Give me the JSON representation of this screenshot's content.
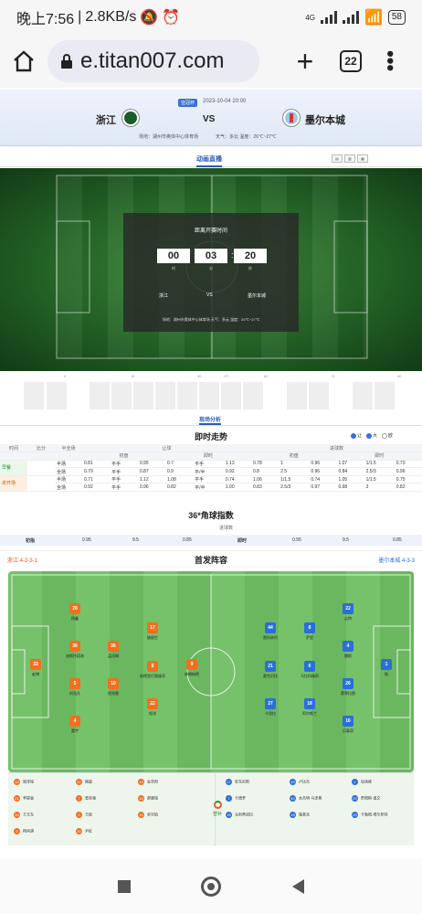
{
  "status": {
    "time": "晚上7:56",
    "speed": "2.8KB/s",
    "network": "4G",
    "battery": "58"
  },
  "browser": {
    "url": "e.titan007.com",
    "tab_count": "22"
  },
  "match": {
    "tag": "亚冠杯",
    "datetime": "2023-10-04 20:00",
    "home": "浙江",
    "vs": "VS",
    "away": "墨尔本城",
    "venue": "场地：湖州市奥体中心体育场",
    "weather": "天气：多云    温度：26℃~27℃"
  },
  "live": {
    "title": "动画直播",
    "view_buttons": [
      "▤",
      "▥",
      "▦"
    ]
  },
  "countdown": {
    "title": "距离开赛时间",
    "hours": "00",
    "minutes": "03",
    "seconds": "20",
    "h_unit": "时",
    "m_unit": "分",
    "s_unit": "秒",
    "home": "浙江",
    "vs": "VS",
    "away": "墨尔本城",
    "footer": "场地：湖州市奥体中心体育场 天气：多云 温度：26℃~27℃"
  },
  "timeline_ticks": [
    "0",
    "15",
    "30",
    "HT",
    "60",
    "75",
    "90"
  ],
  "analysis_tab": "现场分析",
  "odds": {
    "title": "即时走势",
    "legend": [
      "让",
      "大",
      "欧"
    ],
    "head1": [
      "时间",
      "比分",
      "半全场",
      "让球",
      "",
      "",
      "",
      "",
      "",
      "进球数",
      "",
      "",
      "",
      "",
      ""
    ],
    "head2": [
      "",
      "",
      "",
      "初盘",
      "",
      "",
      "即时",
      "",
      "",
      "初盘",
      "",
      "",
      "即时",
      "",
      ""
    ],
    "rows": [
      {
        "label": "早餐",
        "cells": [
          "半场",
          "0.81",
          "平手",
          "0.95",
          "0.7",
          "平手",
          "1.13",
          "0.78",
          "1",
          "0.96",
          "1.07",
          "1/1.5",
          "0.73"
        ]
      },
      {
        "label": "",
        "cells": [
          "全场",
          "0.79",
          "平手",
          "0.87",
          "0.9",
          "平/半",
          "0.92",
          "0.8",
          "2.5",
          "0.96",
          "0.84",
          "2.5/3",
          "0.96"
        ]
      },
      {
        "label": "未开场",
        "cells": [
          "半场",
          "0.71",
          "平手",
          "1.12",
          "1.08",
          "平手",
          "0.74",
          "1.06",
          "1/1.5",
          "0.74",
          "1.05",
          "1/1.5",
          "0.75"
        ]
      },
      {
        "label": "",
        "cells": [
          "全场",
          "0.92",
          "平手",
          "0.96",
          "0.82",
          "平/半",
          "1.00",
          "0.83",
          "2.5/3",
          "0.97",
          "0.98",
          "3",
          "0.82"
        ]
      }
    ]
  },
  "corner": {
    "title": "36*角球指数",
    "head": "进球数",
    "row": [
      "初指",
      "0.95",
      "9.5",
      "0.85",
      "即时",
      "0.95",
      "9.5",
      "0.85"
    ]
  },
  "lineup": {
    "home_formation": "浙江 4-2-3-1",
    "title": "首发阵容",
    "away_formation": "墨尔本城 4-3-3",
    "home_players": [
      {
        "num": "33",
        "name": "赵博"
      },
      {
        "num": "28",
        "name": "杨鑫"
      },
      {
        "num": "36",
        "name": "迪斯托塔洛"
      },
      {
        "num": "5",
        "name": "刘浩凡"
      },
      {
        "num": "4",
        "name": "董宇"
      },
      {
        "num": "26",
        "name": "孟佳琳"
      },
      {
        "num": "10",
        "name": "程晋雷"
      },
      {
        "num": "17",
        "name": "姚俊生"
      },
      {
        "num": "8",
        "name": "安德里尼奥维奇"
      },
      {
        "num": "22",
        "name": "程进"
      },
      {
        "num": "9",
        "name": "弗朗纳德"
      }
    ],
    "away_players": [
      {
        "num": "1",
        "name": "扬"
      },
      {
        "num": "22",
        "name": "吉特"
      },
      {
        "num": "4",
        "name": "雷斯"
      },
      {
        "num": "26",
        "name": "蒙蒂拉图"
      },
      {
        "num": "16",
        "name": "贝泰奇"
      },
      {
        "num": "8",
        "name": "萨里"
      },
      {
        "num": "6",
        "name": "马拉科维奇"
      },
      {
        "num": "18",
        "name": "阿尔斯兰"
      },
      {
        "num": "44",
        "name": "贾科米约"
      },
      {
        "num": "21",
        "name": "麦克贝拉"
      },
      {
        "num": "27",
        "name": "卡里拉"
      }
    ],
    "coach": "替补",
    "home_subs": [
      {
        "num": "16",
        "name": "梁泽铭"
      },
      {
        "num": "11",
        "name": "顾超"
      },
      {
        "num": "13",
        "name": "金浩阳"
      },
      {
        "num": "21",
        "name": "李提香"
      },
      {
        "num": "7",
        "name": "曾亚强"
      },
      {
        "num": "18",
        "name": "郝康瑞"
      },
      {
        "num": "30",
        "name": "王玉东"
      },
      {
        "num": "3",
        "name": "王蛟"
      },
      {
        "num": "15",
        "name": "吴宇航"
      },
      {
        "num": "8",
        "name": "杨丙骐"
      },
      {
        "num": "20",
        "name": "尹虹"
      }
    ],
    "away_subs": [
      {
        "num": "17",
        "name": "安东尼斯"
      },
      {
        "num": "19",
        "name": "卢比杰"
      },
      {
        "num": "2",
        "name": "加洛维"
      },
      {
        "num": "7",
        "name": "卡德罗"
      },
      {
        "num": "40",
        "name": "本杰明·马泽奥"
      },
      {
        "num": "20",
        "name": "詹姆斯·道文"
      },
      {
        "num": "39",
        "name": "派利蒂诺拉"
      },
      {
        "num": "33",
        "name": "施莱克"
      },
      {
        "num": "23",
        "name": "卡勒姆·塔尔邦特"
      }
    ]
  },
  "colors": {
    "home": "#f07020",
    "away": "#2a6fd6",
    "accent": "#2a5bb8"
  }
}
